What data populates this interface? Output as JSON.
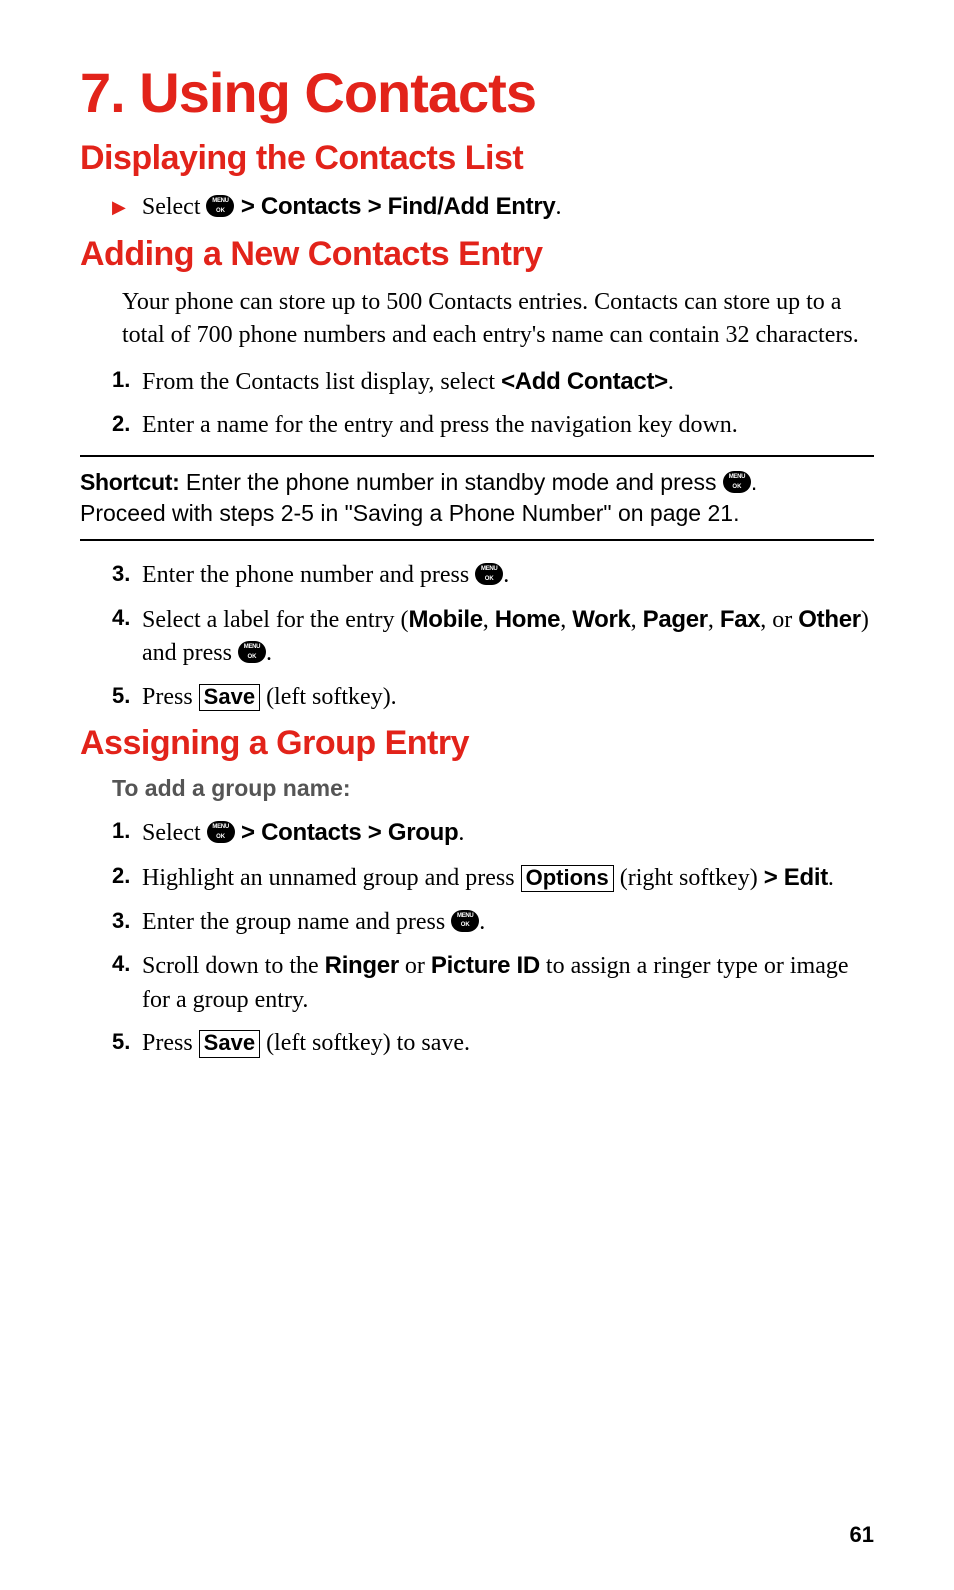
{
  "chapter": {
    "title": "7. Using Contacts"
  },
  "pageNumber": "61",
  "section1": {
    "title": "Displaying the Contacts List",
    "bullet": {
      "pre": "Select ",
      "path": " > Contacts > Find/Add Entry",
      "end": "."
    }
  },
  "section2": {
    "title": "Adding a New Contacts Entry",
    "para": "Your phone can store up to 500 Contacts entries. Contacts can store up to a total of 700 phone numbers and each entry's name can contain 32 characters.",
    "items": {
      "n1": "1.",
      "t1a": "From the Contacts list display, select ",
      "t1b": "<Add Contact>",
      "t1c": ".",
      "n2": "2.",
      "t2": "Enter a name for the entry and press the navigation key down.",
      "n3": "3.",
      "t3a": "Enter the phone number and press ",
      "t3b": ".",
      "n4": "4.",
      "t4a": "Select a label for the entry (",
      "t4mobile": "Mobile",
      "t4c1": ", ",
      "t4home": "Home",
      "t4c2": ", ",
      "t4work": "Work",
      "t4c3": ", ",
      "t4pager": "Pager",
      "t4c4": ", ",
      "t4fax": "Fax",
      "t4c5": ", or ",
      "t4other": "Other",
      "t4end1": ") and press ",
      "t4end2": ".",
      "n5": "5.",
      "t5a": "Press ",
      "t5save": "Save",
      "t5b": " (left softkey)."
    },
    "shortcut": {
      "label": "Shortcut:",
      "line1a": " Enter the phone number in standby mode and press ",
      "line1b": ".",
      "line2": "Proceed with steps 2-5 in \"Saving a Phone Number\" on page 21."
    }
  },
  "section3": {
    "title": "Assigning a Group Entry",
    "sub": "To add a group name:",
    "items": {
      "n1": "1.",
      "t1a": "Select ",
      "t1b": " > Contacts > Group",
      "t1c": ".",
      "n2": "2.",
      "t2a": "Highlight an unnamed group and press ",
      "t2opt": "Options",
      "t2b": " (right softkey) ",
      "t2edit": "> Edit",
      "t2c": ".",
      "n3": "3.",
      "t3a": "Enter the group name and press ",
      "t3b": ".",
      "n4": "4.",
      "t4a": "Scroll down to the ",
      "t4ringer": "Ringer",
      "t4b": " or ",
      "t4pic": "Picture ID",
      "t4c": " to assign a ringer type or image for a group entry.",
      "n5": "5.",
      "t5a": "Press ",
      "t5save": "Save",
      "t5b": " (left softkey) to save."
    }
  }
}
